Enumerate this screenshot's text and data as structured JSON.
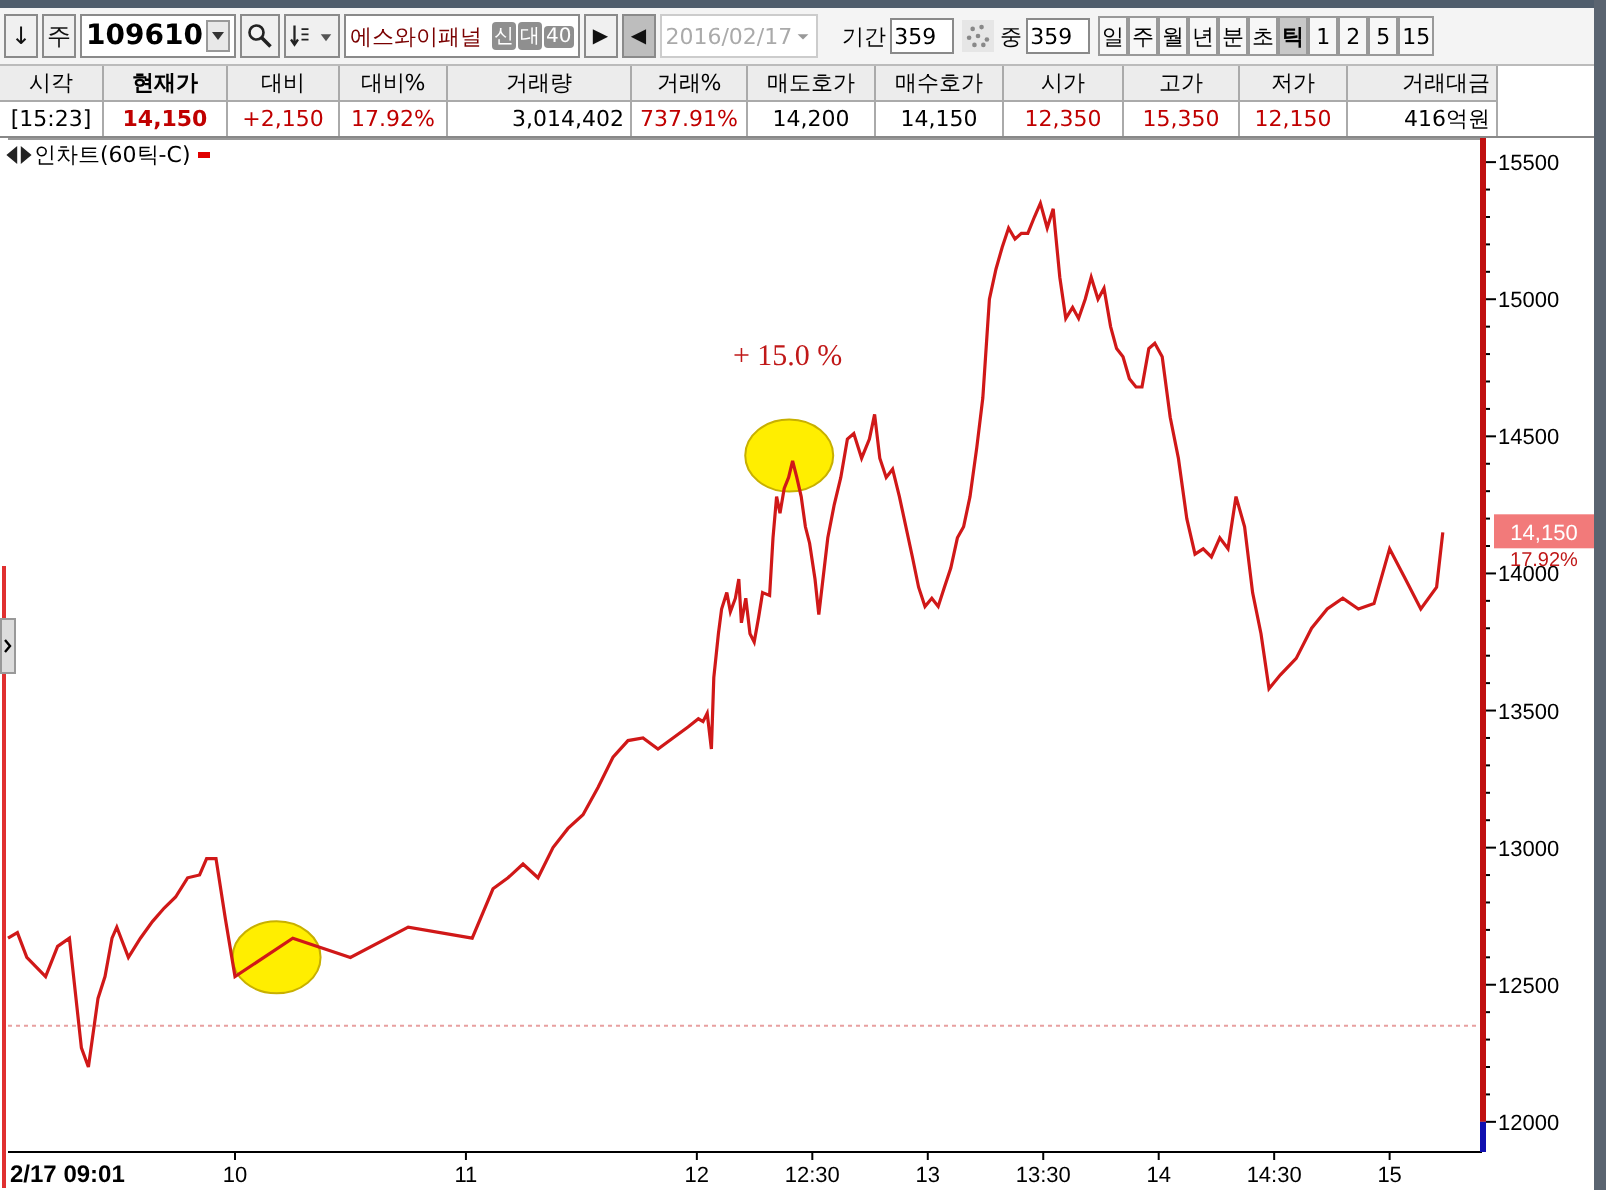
{
  "toolbar": {
    "sort_button": "↓",
    "market_button": "주",
    "code": "109610",
    "name": "에스와이패널",
    "badges": [
      "신",
      "대",
      "40"
    ],
    "play": "▶",
    "back": "◀",
    "date": "2016/02/17",
    "period_label": "기간",
    "period_value": "359",
    "mid_label": "중",
    "mid_value": "359",
    "intervals": [
      {
        "label": "일",
        "selected": false
      },
      {
        "label": "주",
        "selected": false
      },
      {
        "label": "월",
        "selected": false
      },
      {
        "label": "년",
        "selected": false
      },
      {
        "label": "분",
        "selected": false
      },
      {
        "label": "초",
        "selected": false
      },
      {
        "label": "틱",
        "selected": true
      },
      {
        "label": "1",
        "selected": false
      },
      {
        "label": "2",
        "selected": false
      },
      {
        "label": "5",
        "selected": false
      },
      {
        "label": "15",
        "selected": false
      }
    ]
  },
  "quote": {
    "columns": [
      {
        "header": "시각",
        "value": "[15:23]",
        "color": "#000000",
        "bold": false
      },
      {
        "header": "현재가",
        "value": "14,150",
        "color": "#c00000",
        "bold": true
      },
      {
        "header": "대비",
        "value": "+2,150",
        "color": "#c00000",
        "bold": false
      },
      {
        "header": "대비%",
        "value": "17.92%",
        "color": "#c00000",
        "bold": false
      },
      {
        "header": "거래량",
        "value": "3,014,402",
        "color": "#000000",
        "bold": false
      },
      {
        "header": "거래%",
        "value": "737.91%",
        "color": "#c00000",
        "bold": false
      },
      {
        "header": "매도호가",
        "value": "14,200",
        "color": "#000000",
        "bold": false
      },
      {
        "header": "매수호가",
        "value": "14,150",
        "color": "#000000",
        "bold": false
      },
      {
        "header": "시가",
        "value": "12,350",
        "color": "#c00000",
        "bold": false
      },
      {
        "header": "고가",
        "value": "15,350",
        "color": "#c00000",
        "bold": false
      },
      {
        "header": "저가",
        "value": "12,150",
        "color": "#c00000",
        "bold": false
      },
      {
        "header": "거래대금",
        "value": "416억원",
        "color": "#000000",
        "bold": false
      }
    ]
  },
  "chart": {
    "title": "인차트(60틱-C)",
    "price_tag": {
      "value": "14,150",
      "change": "17.92%"
    },
    "chart_data": {
      "type": "line",
      "x": [
        9.017,
        9.058,
        9.098,
        9.18,
        9.232,
        9.283,
        9.335,
        9.365,
        9.407,
        9.437,
        9.467,
        9.488,
        9.538,
        9.59,
        9.642,
        9.693,
        9.743,
        9.795,
        9.847,
        9.877,
        9.918,
        9.958,
        10,
        10.25,
        10.5,
        10.75,
        11.027,
        11.117,
        11.182,
        11.247,
        11.312,
        11.377,
        11.442,
        11.507,
        11.572,
        11.637,
        11.702,
        11.767,
        11.832,
        11.897,
        11.962,
        12.007,
        12.027,
        12.045,
        12.063,
        12.073,
        12.093,
        12.107,
        12.13,
        12.145,
        12.167,
        12.182,
        12.193,
        12.212,
        12.23,
        12.248,
        12.267,
        12.285,
        12.315,
        12.33,
        12.345,
        12.36,
        12.378,
        12.397,
        12.415,
        12.433,
        12.452,
        12.47,
        12.488,
        12.512,
        12.528,
        12.567,
        12.595,
        12.623,
        12.652,
        12.68,
        12.713,
        12.747,
        12.77,
        12.792,
        12.82,
        12.848,
        12.877,
        12.933,
        12.96,
        12.988,
        13.017,
        13.045,
        13.072,
        13.1,
        13.128,
        13.155,
        13.183,
        13.212,
        13.238,
        13.267,
        13.295,
        13.322,
        13.35,
        13.378,
        13.405,
        13.433,
        13.462,
        13.488,
        13.517,
        13.543,
        13.572,
        13.598,
        13.627,
        13.653,
        13.682,
        13.708,
        13.737,
        13.763,
        13.792,
        13.818,
        13.845,
        13.873,
        13.902,
        13.928,
        13.957,
        13.983,
        14.015,
        14.05,
        14.085,
        14.122,
        14.157,
        14.193,
        14.228,
        14.265,
        14.3,
        14.335,
        14.372,
        14.407,
        14.443,
        14.478,
        14.527,
        14.595,
        14.662,
        14.73,
        14.797,
        14.865,
        14.932,
        15,
        15.068,
        15.135,
        15.203,
        15.23
      ],
      "series": [
        {
          "color": "#d01818",
          "values": [
            12670,
            12690,
            12600,
            12530,
            12640,
            12670,
            12270,
            12200,
            12450,
            12530,
            12670,
            12710,
            12600,
            12670,
            12730,
            12780,
            12820,
            12890,
            12900,
            12960,
            12960,
            12740,
            12530,
            12670,
            12600,
            12710,
            12670,
            12850,
            12890,
            12940,
            12890,
            13000,
            13070,
            13120,
            13220,
            13330,
            13390,
            13400,
            13360,
            13400,
            13440,
            13470,
            13460,
            13490,
            13360,
            13620,
            13780,
            13870,
            13930,
            13860,
            13910,
            13980,
            13820,
            13910,
            13780,
            13750,
            13840,
            13930,
            13920,
            14130,
            14280,
            14220,
            14310,
            14350,
            14410,
            14350,
            14280,
            14170,
            14110,
            13980,
            13850,
            14130,
            14250,
            14350,
            14490,
            14510,
            14420,
            14490,
            14580,
            14420,
            14350,
            14380,
            14280,
            14060,
            13950,
            13880,
            13910,
            13880,
            13950,
            14020,
            14130,
            14170,
            14280,
            14460,
            14640,
            15000,
            15110,
            15190,
            15260,
            15220,
            15240,
            15240,
            15300,
            15350,
            15260,
            15330,
            15080,
            14930,
            14970,
            14930,
            15000,
            15080,
            15000,
            15040,
            14900,
            14820,
            14790,
            14710,
            14680,
            14680,
            14820,
            14840,
            14790,
            14570,
            14420,
            14200,
            14070,
            14090,
            14060,
            14130,
            14090,
            14280,
            14170,
            13930,
            13780,
            13580,
            13630,
            13690,
            13800,
            13870,
            13910,
            13870,
            13890,
            14090,
            13980,
            13870,
            13950,
            14150
          ]
        }
      ],
      "xlim": [
        9.017,
        15.4
      ],
      "ylim": [
        11890,
        15588
      ],
      "ref_lines": [
        {
          "axis": "y",
          "value": 12350
        }
      ],
      "xticks": [
        {
          "value": 9.017,
          "label": "2/17 09:01"
        },
        {
          "value": 10,
          "label": "10"
        },
        {
          "value": 11,
          "label": "11"
        },
        {
          "value": 12,
          "label": "12"
        },
        {
          "value": 12.5,
          "label": "12:30"
        },
        {
          "value": 13,
          "label": "13"
        },
        {
          "value": 13.5,
          "label": "13:30"
        },
        {
          "value": 14,
          "label": "14"
        },
        {
          "value": 14.5,
          "label": "14:30"
        },
        {
          "value": 15,
          "label": "15"
        }
      ],
      "yticks": [
        {
          "value": 12000,
          "label": "12000"
        },
        {
          "value": 12500,
          "label": "12500"
        },
        {
          "value": 13000,
          "label": "13000"
        },
        {
          "value": 13500,
          "label": "13500"
        },
        {
          "value": 14000,
          "label": "14000"
        },
        {
          "value": 14500,
          "label": "14500"
        },
        {
          "value": 15000,
          "label": "15000"
        },
        {
          "value": 15500,
          "label": "15500"
        }
      ],
      "annotations": [
        "+ 15.0 %"
      ]
    }
  }
}
